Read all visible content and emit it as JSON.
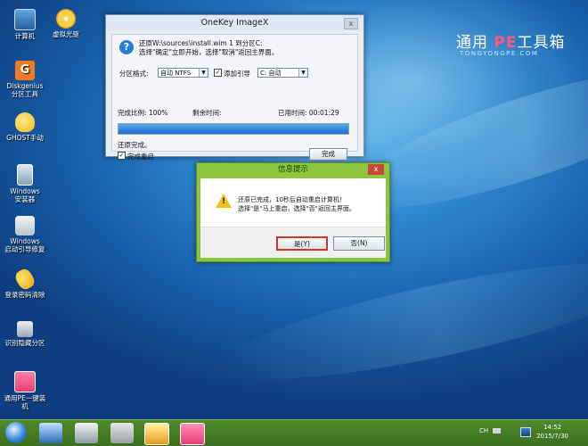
{
  "desktop": {
    "icons": [
      {
        "label": "计算机"
      },
      {
        "label": "虚拟光驱"
      },
      {
        "label": "Diskgenius",
        "label2": "分区工具"
      },
      {
        "label": "GHOST手动"
      },
      {
        "label": "Windows",
        "label2": "安装器"
      },
      {
        "label": "Windows",
        "label2": "启动引导修复"
      },
      {
        "label": "登录密码清除"
      },
      {
        "label": "识别隐藏分区"
      },
      {
        "label": "通用PE一键装",
        "label2": "机"
      }
    ],
    "brand": {
      "pre": "通用 ",
      "pe": "PE",
      "post": "工具箱",
      "url": "TONGYONGPE.COM"
    }
  },
  "onekey": {
    "title": "OneKey ImageX",
    "close": "x",
    "message_line1": "还原W:\\sources\\install.wim 1 到分区C:",
    "message_line2": "选择\"确定\"立即开始，选择\"取消\"返回主界面。",
    "partition_format_label": "分区格式:",
    "partition_format_value": "自动 NTFS",
    "add_boot_label": "添加引导",
    "add_boot_checked": true,
    "boot_drive_value": "C: 自动",
    "progress_label": "完成比例: 100%",
    "remaining_label": "剩余时间:",
    "elapsed_label": "已用时间: 00:01:29",
    "progress_percent": 100,
    "status_text": "还原完成。",
    "restart_label": "完成重启",
    "restart_checked": true,
    "finish_button": "完成"
  },
  "info_dialog": {
    "title": "信息提示",
    "close": "x",
    "line1": "还原已完成，10秒后自动重启计算机！",
    "line2": "选择\"是\"马上重启，选择\"否\"返回主界面。",
    "yes_button": "是(Y)",
    "no_button": "否(N)"
  },
  "taskbar": {
    "lang": "CH",
    "time": "14:52",
    "date": "2015/7/30"
  },
  "colors": {
    "accent": "#2b7cd3",
    "dialog_green": "#8cc63f",
    "taskbar": "#3b6f1f"
  }
}
